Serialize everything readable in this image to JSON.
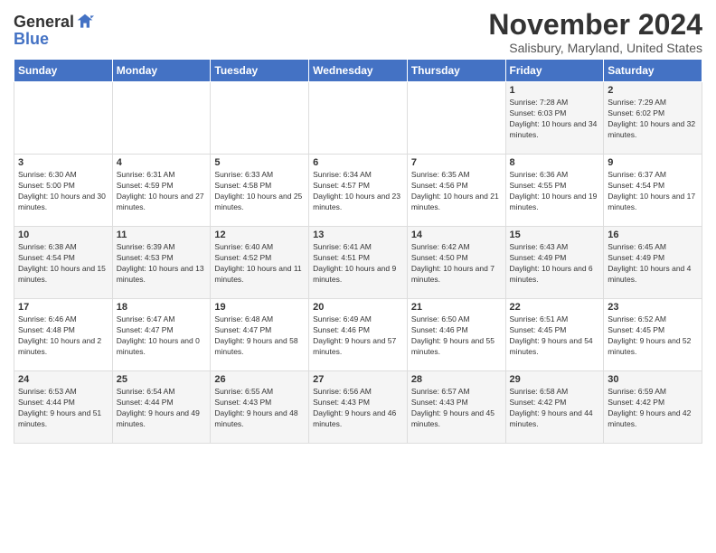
{
  "header": {
    "logo_general": "General",
    "logo_blue": "Blue",
    "month": "November 2024",
    "location": "Salisbury, Maryland, United States"
  },
  "weekdays": [
    "Sunday",
    "Monday",
    "Tuesday",
    "Wednesday",
    "Thursday",
    "Friday",
    "Saturday"
  ],
  "weeks": [
    [
      {
        "day": "",
        "info": ""
      },
      {
        "day": "",
        "info": ""
      },
      {
        "day": "",
        "info": ""
      },
      {
        "day": "",
        "info": ""
      },
      {
        "day": "",
        "info": ""
      },
      {
        "day": "1",
        "info": "Sunrise: 7:28 AM\nSunset: 6:03 PM\nDaylight: 10 hours and 34 minutes."
      },
      {
        "day": "2",
        "info": "Sunrise: 7:29 AM\nSunset: 6:02 PM\nDaylight: 10 hours and 32 minutes."
      }
    ],
    [
      {
        "day": "3",
        "info": "Sunrise: 6:30 AM\nSunset: 5:00 PM\nDaylight: 10 hours and 30 minutes."
      },
      {
        "day": "4",
        "info": "Sunrise: 6:31 AM\nSunset: 4:59 PM\nDaylight: 10 hours and 27 minutes."
      },
      {
        "day": "5",
        "info": "Sunrise: 6:33 AM\nSunset: 4:58 PM\nDaylight: 10 hours and 25 minutes."
      },
      {
        "day": "6",
        "info": "Sunrise: 6:34 AM\nSunset: 4:57 PM\nDaylight: 10 hours and 23 minutes."
      },
      {
        "day": "7",
        "info": "Sunrise: 6:35 AM\nSunset: 4:56 PM\nDaylight: 10 hours and 21 minutes."
      },
      {
        "day": "8",
        "info": "Sunrise: 6:36 AM\nSunset: 4:55 PM\nDaylight: 10 hours and 19 minutes."
      },
      {
        "day": "9",
        "info": "Sunrise: 6:37 AM\nSunset: 4:54 PM\nDaylight: 10 hours and 17 minutes."
      }
    ],
    [
      {
        "day": "10",
        "info": "Sunrise: 6:38 AM\nSunset: 4:54 PM\nDaylight: 10 hours and 15 minutes."
      },
      {
        "day": "11",
        "info": "Sunrise: 6:39 AM\nSunset: 4:53 PM\nDaylight: 10 hours and 13 minutes."
      },
      {
        "day": "12",
        "info": "Sunrise: 6:40 AM\nSunset: 4:52 PM\nDaylight: 10 hours and 11 minutes."
      },
      {
        "day": "13",
        "info": "Sunrise: 6:41 AM\nSunset: 4:51 PM\nDaylight: 10 hours and 9 minutes."
      },
      {
        "day": "14",
        "info": "Sunrise: 6:42 AM\nSunset: 4:50 PM\nDaylight: 10 hours and 7 minutes."
      },
      {
        "day": "15",
        "info": "Sunrise: 6:43 AM\nSunset: 4:49 PM\nDaylight: 10 hours and 6 minutes."
      },
      {
        "day": "16",
        "info": "Sunrise: 6:45 AM\nSunset: 4:49 PM\nDaylight: 10 hours and 4 minutes."
      }
    ],
    [
      {
        "day": "17",
        "info": "Sunrise: 6:46 AM\nSunset: 4:48 PM\nDaylight: 10 hours and 2 minutes."
      },
      {
        "day": "18",
        "info": "Sunrise: 6:47 AM\nSunset: 4:47 PM\nDaylight: 10 hours and 0 minutes."
      },
      {
        "day": "19",
        "info": "Sunrise: 6:48 AM\nSunset: 4:47 PM\nDaylight: 9 hours and 58 minutes."
      },
      {
        "day": "20",
        "info": "Sunrise: 6:49 AM\nSunset: 4:46 PM\nDaylight: 9 hours and 57 minutes."
      },
      {
        "day": "21",
        "info": "Sunrise: 6:50 AM\nSunset: 4:46 PM\nDaylight: 9 hours and 55 minutes."
      },
      {
        "day": "22",
        "info": "Sunrise: 6:51 AM\nSunset: 4:45 PM\nDaylight: 9 hours and 54 minutes."
      },
      {
        "day": "23",
        "info": "Sunrise: 6:52 AM\nSunset: 4:45 PM\nDaylight: 9 hours and 52 minutes."
      }
    ],
    [
      {
        "day": "24",
        "info": "Sunrise: 6:53 AM\nSunset: 4:44 PM\nDaylight: 9 hours and 51 minutes."
      },
      {
        "day": "25",
        "info": "Sunrise: 6:54 AM\nSunset: 4:44 PM\nDaylight: 9 hours and 49 minutes."
      },
      {
        "day": "26",
        "info": "Sunrise: 6:55 AM\nSunset: 4:43 PM\nDaylight: 9 hours and 48 minutes."
      },
      {
        "day": "27",
        "info": "Sunrise: 6:56 AM\nSunset: 4:43 PM\nDaylight: 9 hours and 46 minutes."
      },
      {
        "day": "28",
        "info": "Sunrise: 6:57 AM\nSunset: 4:43 PM\nDaylight: 9 hours and 45 minutes."
      },
      {
        "day": "29",
        "info": "Sunrise: 6:58 AM\nSunset: 4:42 PM\nDaylight: 9 hours and 44 minutes."
      },
      {
        "day": "30",
        "info": "Sunrise: 6:59 AM\nSunset: 4:42 PM\nDaylight: 9 hours and 42 minutes."
      }
    ]
  ]
}
